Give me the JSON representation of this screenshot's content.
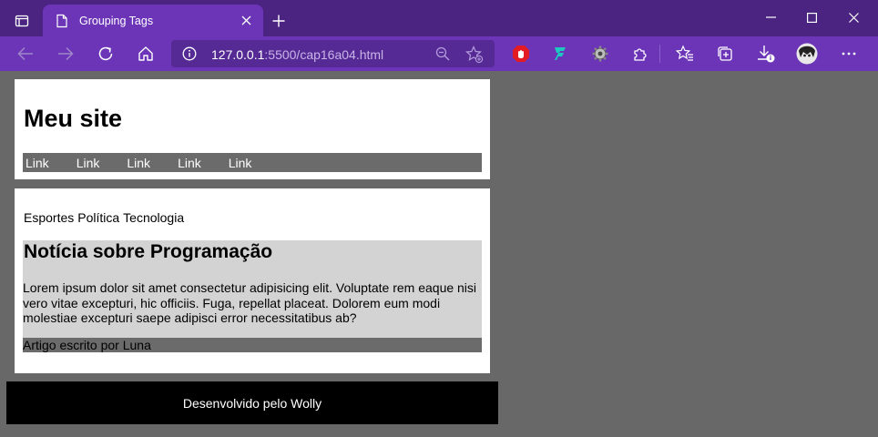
{
  "browser": {
    "tab_title": "Grouping Tags",
    "url_host": "127.0.0.1",
    "url_path": ":5500/cap16a04.html"
  },
  "page": {
    "site_title": "Meu site",
    "nav_links": [
      "Link",
      "Link",
      "Link",
      "Link",
      "Link"
    ],
    "categories": [
      "Esportes",
      "Política",
      "Tecnologia"
    ],
    "article": {
      "title": "Notícia sobre Programação",
      "body": "Lorem ipsum dolor sit amet consectetur adipisicing elit. Voluptate rem eaque nisi vero vitae excepturi, hic officiis. Fuga, repellat placeat. Dolorem eum modi molestiae excepturi saepe adipisci error necessitatibus ab?",
      "footer": "Artigo escrito por Luna"
    },
    "footer": "Desenvolvido pelo Wolly"
  },
  "colors": {
    "titlebar": "#4a2480",
    "toolbar": "#6c35b8",
    "page_background": "#686868",
    "nav_background": "#6b6b6b",
    "article_background": "#d3d3d3",
    "footer_background": "#000000"
  },
  "icons": {
    "tab_actions": "tab-actions-icon",
    "page": "page-icon",
    "close": "close-icon",
    "new_tab": "plus-icon",
    "minimize": "minimize-icon",
    "maximize": "maximize-icon",
    "window_close": "window-close-icon",
    "back": "back-arrow-icon",
    "forward": "forward-arrow-icon",
    "refresh": "refresh-icon",
    "home": "home-icon",
    "info": "info-icon",
    "zoom": "zoom-out-icon",
    "favorite": "add-favorite-icon",
    "extensions": [
      "adblock-icon",
      "figma-extension-icon",
      "gear-extension-icon",
      "extensions-puzzle-icon"
    ],
    "favorites": "favorites-icon",
    "collections": "collections-icon",
    "downloads": "downloads-icon",
    "profile": "profile-avatar",
    "menu": "more-menu-icon"
  }
}
